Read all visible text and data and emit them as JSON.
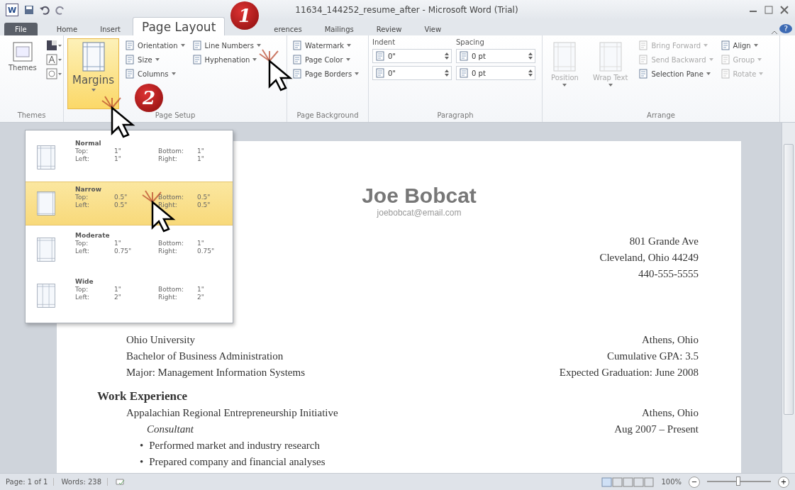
{
  "window": {
    "logo": "W",
    "title": "11634_144252_resume_after - Microsoft Word (Trial)",
    "help": "?"
  },
  "tabs": [
    {
      "label": "File",
      "kind": "file",
      "selected": false
    },
    {
      "label": "Home",
      "kind": "tab",
      "selected": false
    },
    {
      "label": "Insert",
      "kind": "tab",
      "selected": false
    },
    {
      "label": "Page Layout",
      "kind": "tab",
      "selected": true
    },
    {
      "label": "erences",
      "kind": "tab",
      "selected": false
    },
    {
      "label": "Mailings",
      "kind": "tab",
      "selected": false
    },
    {
      "label": "Review",
      "kind": "tab",
      "selected": false
    },
    {
      "label": "View",
      "kind": "tab",
      "selected": false
    }
  ],
  "ribbon": [
    {
      "label": "Themes",
      "kind": "themes",
      "large": [
        {
          "label": "Themes",
          "pressed": false,
          "disabled": false
        }
      ]
    },
    {
      "label": "Page Setup",
      "kind": "buttons",
      "large": [
        {
          "label": "Margins",
          "pressed": true,
          "disabled": false
        }
      ],
      "small": [
        {
          "label": "Orientation",
          "disabled": false
        },
        {
          "label": "Size",
          "disabled": false
        },
        {
          "label": "Columns",
          "disabled": false
        },
        {
          "label": "Line Numbers",
          "disabled": false
        },
        {
          "label": "Hyphenation",
          "disabled": false
        }
      ]
    },
    {
      "label": "Page Background",
      "kind": "buttons",
      "small": [
        {
          "label": "Watermark",
          "disabled": false
        },
        {
          "label": "Page Color",
          "disabled": false
        },
        {
          "label": "Page Borders",
          "disabled": false
        }
      ]
    },
    {
      "label": "Paragraph",
      "kind": "paragraph",
      "indent": {
        "label": "Indent",
        "values": [
          "0\"",
          "0\""
        ]
      },
      "spacing": {
        "label": "Spacing",
        "values": [
          "0 pt",
          "0 pt"
        ]
      }
    },
    {
      "label": "Arrange",
      "kind": "buttons",
      "large": [
        {
          "label": "Position",
          "pressed": false,
          "disabled": true
        },
        {
          "label": "Wrap Text",
          "pressed": false,
          "disabled": true
        }
      ],
      "small": [
        {
          "label": "Bring Forward",
          "disabled": true
        },
        {
          "label": "Send Backward",
          "disabled": true
        },
        {
          "label": "Selection Pane",
          "disabled": false
        },
        {
          "label": "Align",
          "disabled": false
        },
        {
          "label": "Group",
          "disabled": true
        },
        {
          "label": "Rotate",
          "disabled": true
        }
      ]
    }
  ],
  "margins_menu": [
    {
      "name": "Normal",
      "selected": false,
      "fields": [
        {
          "label": "Top:",
          "value": "1\""
        },
        {
          "label": "Bottom:",
          "value": "1\""
        },
        {
          "label": "Left:",
          "value": "1\""
        },
        {
          "label": "Right:",
          "value": "1\""
        }
      ]
    },
    {
      "name": "Narrow",
      "selected": true,
      "fields": [
        {
          "label": "Top:",
          "value": "0.5\""
        },
        {
          "label": "Bottom:",
          "value": "0.5\""
        },
        {
          "label": "Left:",
          "value": "0.5\""
        },
        {
          "label": "Right:",
          "value": "0.5\""
        }
      ]
    },
    {
      "name": "Moderate",
      "selected": false,
      "fields": [
        {
          "label": "Top:",
          "value": "1\""
        },
        {
          "label": "Bottom:",
          "value": "1\""
        },
        {
          "label": "Left:",
          "value": "0.75\""
        },
        {
          "label": "Right:",
          "value": "0.75\""
        }
      ]
    },
    {
      "name": "Wide",
      "selected": false,
      "fields": [
        {
          "label": "Top:",
          "value": "1\""
        },
        {
          "label": "Bottom:",
          "value": "1\""
        },
        {
          "label": "Left:",
          "value": "2\""
        },
        {
          "label": "Right:",
          "value": "2\""
        }
      ]
    }
  ],
  "document": {
    "name": "Joe Bobcat",
    "email": "joebobcat@email.com",
    "address": [
      "801 Grande Ave",
      "Cleveland, Ohio 44249",
      "440-555-5555"
    ],
    "blocks": [
      {
        "kind": "row",
        "left": "Ohio University",
        "right": "Athens, Ohio"
      },
      {
        "kind": "row",
        "left": "Bachelor of Business Administration",
        "right": "Cumulative GPA: 3.5"
      },
      {
        "kind": "row",
        "left": "Major: Management Information Systems",
        "right": "Expected Graduation: June 2008"
      },
      {
        "kind": "heading",
        "text": "Work Experience"
      },
      {
        "kind": "row",
        "left": "Appalachian Regional Entrepreneurship Initiative",
        "right": "Athens, Ohio"
      },
      {
        "kind": "role",
        "left": "Consultant",
        "right": "Aug 2007 – Present"
      },
      {
        "kind": "bullet",
        "marker": "•",
        "text": "Performed market and industry research"
      },
      {
        "kind": "bullet",
        "marker": "•",
        "text": "Prepared company and financial analyses"
      }
    ]
  },
  "callouts": [
    {
      "number": "1"
    },
    {
      "number": "2"
    }
  ],
  "status_bar": {
    "page": "Page: 1 of 1",
    "words": "Words: 238",
    "zoom": "100%",
    "zoom_out": "−",
    "zoom_in": "+",
    "zoom_level": {
      "level": 0.5
    }
  }
}
